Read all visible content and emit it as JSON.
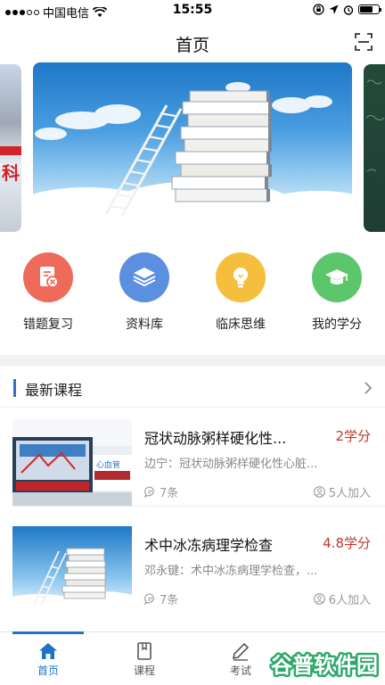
{
  "status_bar": {
    "carrier": "中国电信",
    "time": "15:55",
    "battery_level": 0.7,
    "icons": [
      "signal-icon",
      "wifi-icon",
      "rotation-lock-icon",
      "location-icon",
      "alarm-icon",
      "battery-icon"
    ]
  },
  "nav": {
    "title": "首页",
    "scan_icon": "scan-icon"
  },
  "banner": {
    "side_left_glyph": "科"
  },
  "quick_menu": [
    {
      "label": "错题复习",
      "icon": "wrong-answers-icon",
      "color": "#ee6b5b"
    },
    {
      "label": "资料库",
      "icon": "layers-icon",
      "color": "#5b8fe0"
    },
    {
      "label": "临床思维",
      "icon": "lightbulb-icon",
      "color": "#f5be3c"
    },
    {
      "label": "我的学分",
      "icon": "graduation-cap-icon",
      "color": "#5cc66a"
    }
  ],
  "section": {
    "title": "最新课程"
  },
  "courses": [
    {
      "title": "冠状动脉粥样硬化性...",
      "credit": "2学分",
      "desc": "边宁：冠状动脉粥样硬化性心脏...",
      "comments": "7条",
      "joined": "5人加入",
      "thumb_caption": "心血管"
    },
    {
      "title": "术中冰冻病理学检查",
      "credit": "4.8学分",
      "desc": "邓永键：术中冰冻病理学检查，...",
      "comments": "7条",
      "joined": "6人加入"
    }
  ],
  "tabbar": {
    "tabs": [
      {
        "label": "首页",
        "icon": "home-icon",
        "active": true
      },
      {
        "label": "课程",
        "icon": "book-icon",
        "active": false
      },
      {
        "label": "考试",
        "icon": "pencil-icon",
        "active": false
      }
    ]
  },
  "watermark": {
    "text": "谷普软件园"
  },
  "colors": {
    "accent": "#1e73c9",
    "credit": "#c0392b"
  }
}
